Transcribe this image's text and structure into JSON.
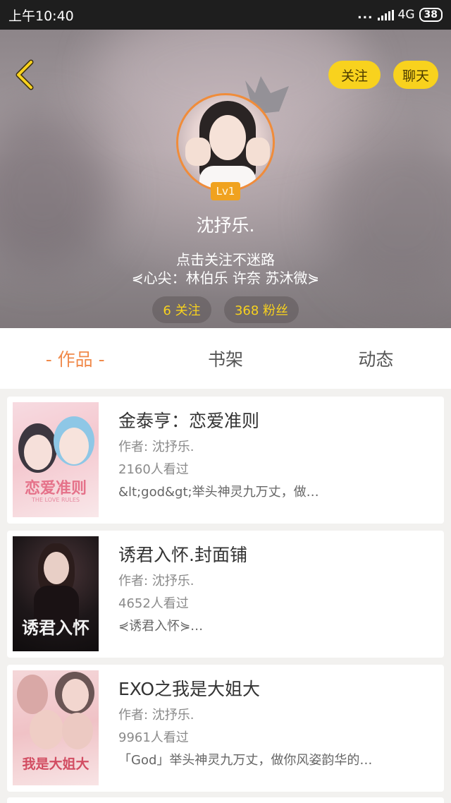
{
  "status_bar": {
    "time": "上午10:40",
    "signal_dots": "...",
    "network": "4G",
    "battery": "38"
  },
  "header": {
    "back_icon": "chevron-left-icon",
    "follow_label": "关注",
    "chat_label": "聊天",
    "level": "Lv1",
    "nickname": "沈抒乐.",
    "bio_line1": "点击关注不迷路",
    "bio_line2": "⋞心尖：林伯乐 许奈 苏沐微⋟",
    "following": "6 关注",
    "fans": "368 粉丝",
    "accent_color": "#f8d21e"
  },
  "tabs": [
    {
      "label": "- 作品 -",
      "active": true
    },
    {
      "label": "书架",
      "active": false
    },
    {
      "label": "动态",
      "active": false
    }
  ],
  "books": [
    {
      "title": "金泰亨：恋爱准则",
      "author": "作者: 沈抒乐.",
      "views": "2160人看过",
      "desc": "&lt;god&gt;举头神灵九万丈，做…",
      "cover_text": "恋爱准则",
      "cover_subtext": "THE LOVE RULES"
    },
    {
      "title": "诱君入怀.封面铺",
      "author": "作者: 沈抒乐.",
      "views": "4652人看过",
      "desc": "⋞诱君入怀⋟…",
      "cover_text": "诱君入怀",
      "cover_subtext": ""
    },
    {
      "title": "EXO之我是大姐大",
      "author": "作者: 沈抒乐.",
      "views": "9961人看过",
      "desc": "「God」举头神灵九万丈，做你风姿韵华的…",
      "cover_text": "我是大姐大",
      "cover_subtext": ""
    }
  ]
}
